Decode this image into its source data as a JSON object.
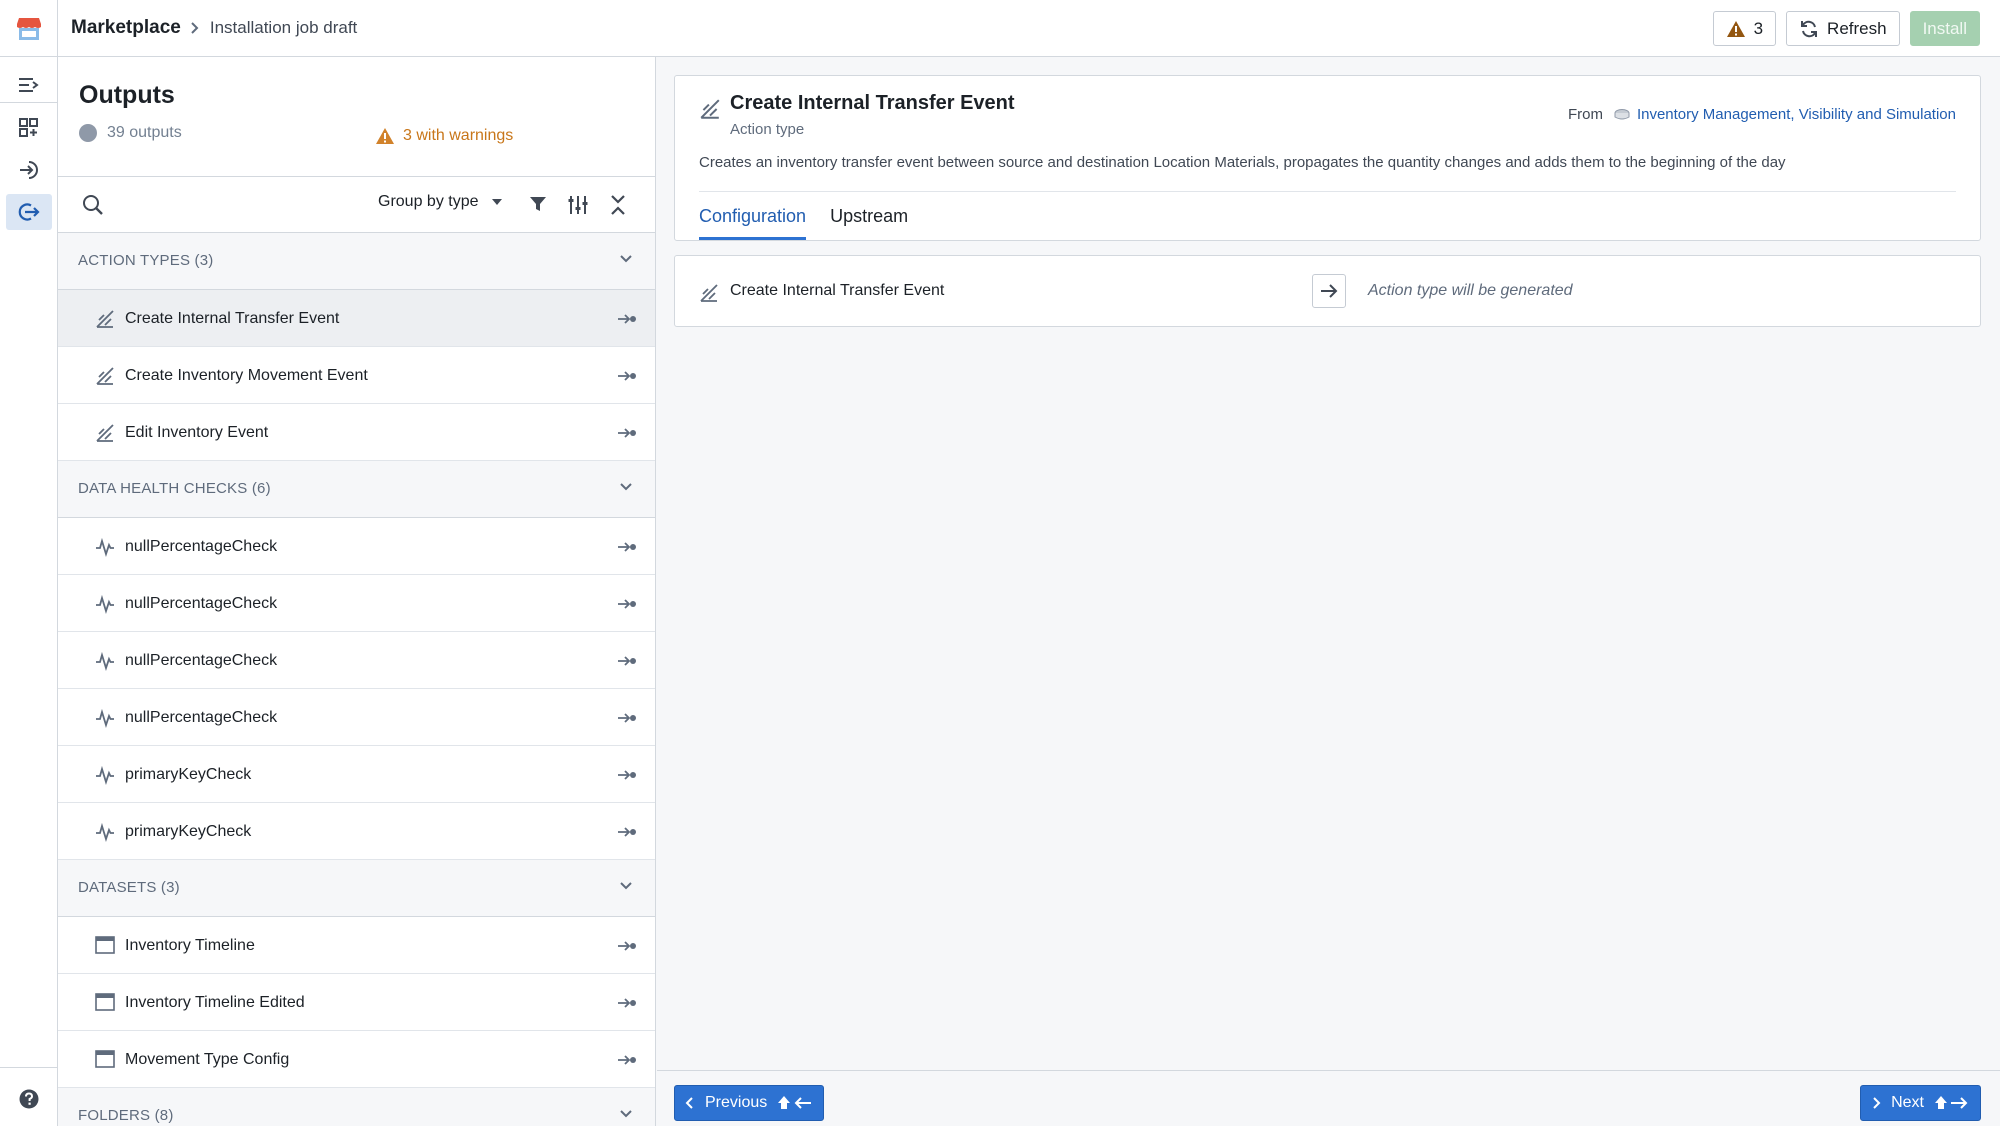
{
  "breadcrumb": {
    "root": "Marketplace",
    "current": "Installation job draft"
  },
  "topbar": {
    "warning_count": "3",
    "refresh_label": "Refresh",
    "install_label": "Install"
  },
  "outputs": {
    "title": "Outputs",
    "count_label": "39 outputs",
    "warnings_label": "3 with warnings",
    "group_by_label": "Group by type",
    "sections": [
      {
        "label": "ACTION TYPES (3)",
        "items": [
          "Create Internal Transfer Event",
          "Create Inventory Movement Event",
          "Edit Inventory Event"
        ]
      },
      {
        "label": "DATA HEALTH CHECKS (6)",
        "items": [
          "nullPercentageCheck",
          "nullPercentageCheck",
          "nullPercentageCheck",
          "nullPercentageCheck",
          "primaryKeyCheck",
          "primaryKeyCheck"
        ]
      },
      {
        "label": "DATASETS (3)",
        "items": [
          "Inventory Timeline",
          "Inventory Timeline Edited",
          "Movement Type Config"
        ]
      },
      {
        "label": "FOLDERS (8)"
      }
    ]
  },
  "detail": {
    "title": "Create Internal Transfer Event",
    "subtitle": "Action type",
    "from_label": "From",
    "from_link": "Inventory Management, Visibility and Simulation",
    "description": "Creates an inventory transfer event between source and destination Location Materials, propagates the quantity changes and adds them to the beginning of the day",
    "tabs": [
      "Configuration",
      "Upstream"
    ],
    "active_tab": "Configuration"
  },
  "config": {
    "item_label": "Create Internal Transfer Event",
    "note": "Action type will be generated"
  },
  "footer": {
    "previous_label": "Previous",
    "next_label": "Next"
  },
  "colors": {
    "accent": "#2d72d2",
    "link": "#215db0",
    "warning": "#c87619",
    "install_disabled": "#a5d0b0",
    "logo": "#e5553f"
  }
}
